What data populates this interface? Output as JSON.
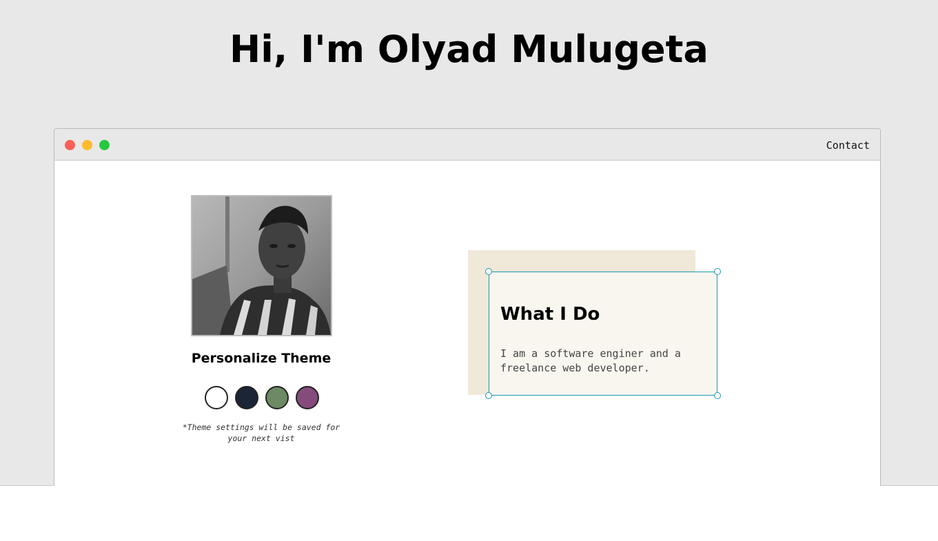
{
  "hero": {
    "title": "Hi, I'm Olyad Mulugeta"
  },
  "window": {
    "controls": [
      "close",
      "minimize",
      "maximize"
    ],
    "contact_label": "Contact"
  },
  "profile": {
    "avatar_icon": "portrait-photo",
    "theme_title": "Personalize Theme",
    "theme_swatches": [
      {
        "name": "light",
        "color": "#ffffff"
      },
      {
        "name": "dark-blue",
        "color": "#1b2535"
      },
      {
        "name": "green",
        "color": "#6c8a64"
      },
      {
        "name": "purple",
        "color": "#844b7b"
      }
    ],
    "theme_note": "*Theme settings will be saved for your next vist"
  },
  "about": {
    "title": "What I Do",
    "text": "I am a software enginer and a freelance web developer."
  },
  "colors": {
    "page_bg": "#e8e8e8",
    "card_bg": "#f8f6ef",
    "card_shadow": "#f0e8d8",
    "selection": "#1a9ab0"
  }
}
